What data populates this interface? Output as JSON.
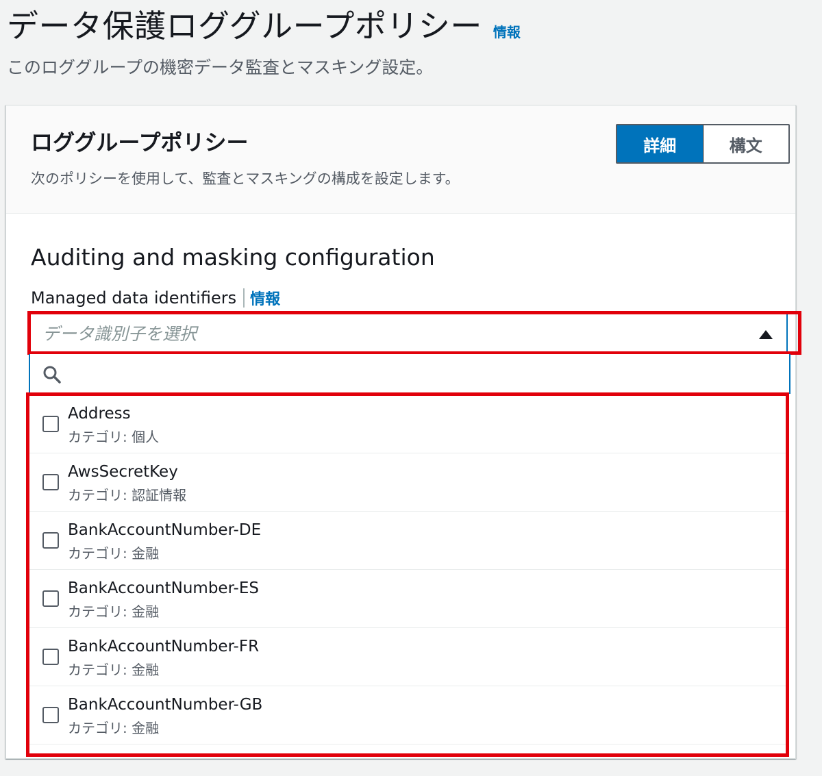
{
  "header": {
    "title": "データ保護ロググループポリシー",
    "info_link": "情報",
    "description": "このロググループの機密データ監査とマスキング設定。"
  },
  "panel": {
    "title": "ロググループポリシー",
    "description": "次のポリシーを使用して、監査とマスキングの構成を設定します。",
    "segments": [
      {
        "label": "詳細",
        "active": true
      },
      {
        "label": "構文",
        "active": false
      }
    ]
  },
  "section": {
    "title": "Auditing and masking configuration",
    "field_label": "Managed data identifiers",
    "info_link": "情報"
  },
  "select": {
    "placeholder": "データ識別子を選択",
    "search_value": ""
  },
  "options": [
    {
      "name": "Address",
      "category": "カテゴリ: 個人"
    },
    {
      "name": "AwsSecretKey",
      "category": "カテゴリ: 認証情報"
    },
    {
      "name": "BankAccountNumber-DE",
      "category": "カテゴリ: 金融"
    },
    {
      "name": "BankAccountNumber-ES",
      "category": "カテゴリ: 金融"
    },
    {
      "name": "BankAccountNumber-FR",
      "category": "カテゴリ: 金融"
    },
    {
      "name": "BankAccountNumber-GB",
      "category": "カテゴリ: 金融"
    }
  ],
  "colors": {
    "accent": "#0073bb",
    "highlight": "#e1000a"
  }
}
